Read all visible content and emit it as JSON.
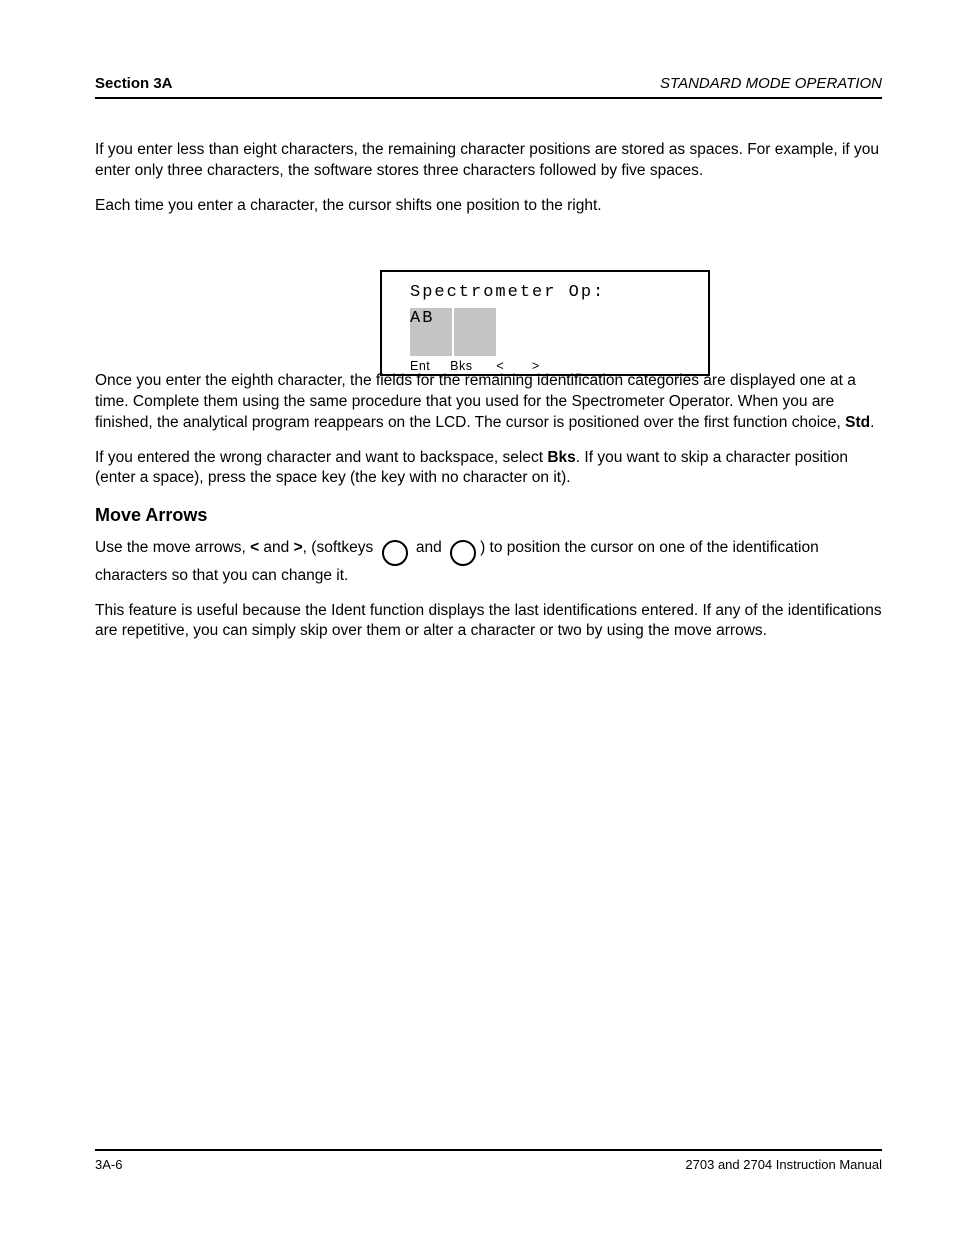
{
  "header": {
    "left": "Section 3A",
    "right": "STANDARD MODE OPERATION"
  },
  "footer": {
    "left": "3A-6",
    "right": "2703 and 2704 Instruction Manual"
  },
  "para1": "If you enter less than eight characters, the remaining character positions are stored as spaces. For example, if you enter only three characters, the software stores three characters followed by five spaces.",
  "para2": "Each time you enter a character, the cursor shifts one position to the right.",
  "lcd": {
    "line1": "Spectrometer Op:",
    "line2": "AB",
    "label": "Ent     Bks      <       >"
  },
  "para3a": "Once you enter the eighth character, the fields for the remaining identification categories are displayed one at a time. Complete them using the same procedure that you used for the Spectrometer Operator. When you are finished, the analytical program reappears on the LCD. The cursor is positioned over the first function choice, ",
  "para3b_strong": "Std",
  "para3c": ".",
  "para4a": "If you entered the wrong character and want to backspace, select ",
  "para4b_strong": "Bks",
  "para4c": ". If you want to skip a character position (enter a space), press the space key (the key with no character on it).",
  "h2": "Move Arrows",
  "para5a": "Use the move arrows, ",
  "para5b_strong": "<",
  "para5c": " and ",
  "para5d_strong": ">",
  "para5e": ", (softkeys ",
  "para5f": " and ",
  "para5g": ") to position the cursor on one of the identification characters so that you can change it.",
  "para6": "This feature is useful because the Ident function displays the last identifications entered. If any of the identifications are repetitive, you can simply skip over them or alter a character or two by using the move arrows."
}
